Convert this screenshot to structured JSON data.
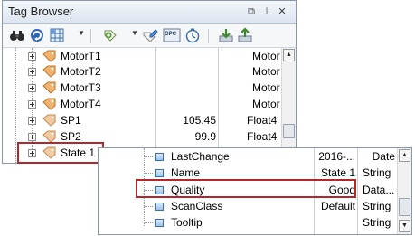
{
  "panel": {
    "title": "Tag Browser",
    "title_buttons": [
      {
        "name": "restore-window-button",
        "glyph": "⧉"
      },
      {
        "name": "pin-button",
        "glyph": "⊥"
      },
      {
        "name": "close-button",
        "glyph": "✕"
      }
    ]
  },
  "toolbar": {
    "tools": [
      "binoculars-icon",
      "refresh-icon",
      "grid-icon",
      "new-tag-icon",
      "edit-tag-icon",
      "opc-icon",
      "timer-icon",
      "import-icon",
      "export-icon"
    ],
    "opc_label": "OPC"
  },
  "tags": [
    {
      "name": "MotorT1",
      "value": "",
      "type": "Motor"
    },
    {
      "name": "MotorT2",
      "value": "",
      "type": "Motor"
    },
    {
      "name": "MotorT3",
      "value": "",
      "type": "Motor"
    },
    {
      "name": "MotorT4",
      "value": "",
      "type": "Motor"
    },
    {
      "name": "SP1",
      "value": "105.45",
      "type": "Float4"
    },
    {
      "name": "SP2",
      "value": "99.9",
      "type": "Float4"
    },
    {
      "name": "State 1",
      "value": "",
      "type": ""
    }
  ],
  "properties": [
    {
      "name": "LastChange",
      "value": "2016-...",
      "type": "Date"
    },
    {
      "name": "Name",
      "value": "State 1",
      "type": "String"
    },
    {
      "name": "Quality",
      "value": "Good",
      "type": "Data..."
    },
    {
      "name": "ScanClass",
      "value": "Default",
      "type": "String"
    },
    {
      "name": "Tooltip",
      "value": "",
      "type": "String"
    }
  ],
  "colors": {
    "highlight": "#b3262b",
    "tag_icon": "#e9a35a"
  }
}
